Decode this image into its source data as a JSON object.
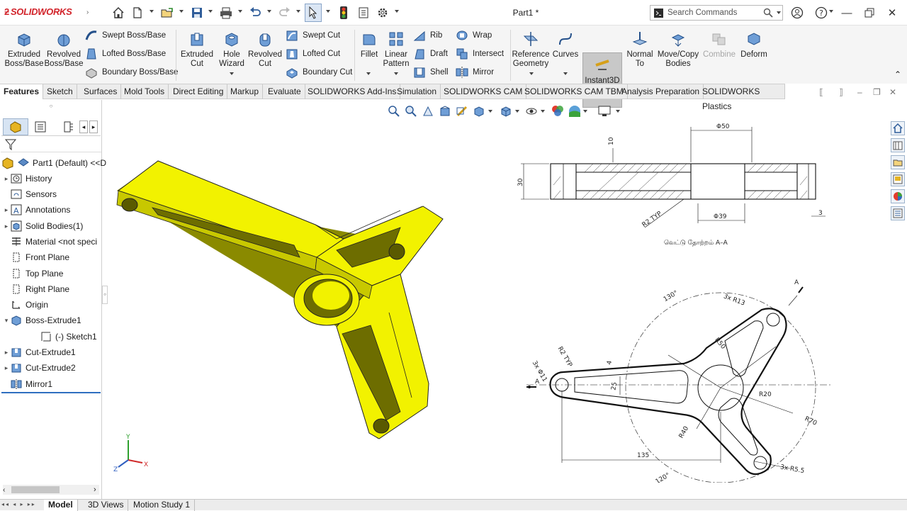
{
  "app": {
    "brand": "SOLIDWORKS",
    "doc_title": "Part1 *",
    "search_placeholder": "Search Commands"
  },
  "ribbon": {
    "extruded_boss": "Extruded Boss/Base",
    "extruded_boss_l1": "Extruded",
    "extruded_boss_l2": "Boss/Base",
    "revolved_boss_l1": "Revolved",
    "revolved_boss_l2": "Boss/Base",
    "swept_boss": "Swept Boss/Base",
    "lofted_boss": "Lofted Boss/Base",
    "boundary_boss": "Boundary Boss/Base",
    "extruded_cut_l1": "Extruded",
    "extruded_cut_l2": "Cut",
    "hole_wizard_l1": "Hole",
    "hole_wizard_l2": "Wizard",
    "revolved_cut_l1": "Revolved",
    "revolved_cut_l2": "Cut",
    "swept_cut": "Swept Cut",
    "lofted_cut": "Lofted Cut",
    "boundary_cut": "Boundary Cut",
    "fillet": "Fillet",
    "linear_pattern_l1": "Linear",
    "linear_pattern_l2": "Pattern",
    "rib": "Rib",
    "draft": "Draft",
    "shell": "Shell",
    "wrap": "Wrap",
    "intersect": "Intersect",
    "mirror": "Mirror",
    "ref_geom_l1": "Reference",
    "ref_geom_l2": "Geometry",
    "curves": "Curves",
    "instant3d": "Instant3D",
    "normal_to_l1": "Normal",
    "normal_to_l2": "To",
    "move_copy_l1": "Move/Copy",
    "move_copy_l2": "Bodies",
    "combine": "Combine",
    "deform": "Deform"
  },
  "tabs": [
    "Features",
    "Sketch",
    "Surfaces",
    "Mold Tools",
    "Direct Editing",
    "Markup",
    "Evaluate",
    "SOLIDWORKS Add-Ins",
    "Simulation",
    "SOLIDWORKS CAM",
    "SOLIDWORKS CAM TBM",
    "Analysis Preparation",
    "SOLIDWORKS Plastics"
  ],
  "tree": {
    "root": "Part1 (Default) <<D",
    "items": [
      "History",
      "Sensors",
      "Annotations",
      "Solid Bodies(1)",
      "Material <not speci",
      "Front Plane",
      "Top Plane",
      "Right Plane",
      "Origin",
      "Boss-Extrude1",
      "(-) Sketch1",
      "Cut-Extrude1",
      "Cut-Extrude2",
      "Mirror1"
    ]
  },
  "bottom_tabs": [
    "Model",
    "3D Views",
    "Motion Study 1"
  ],
  "drawing": {
    "section_label": "வெட்டு தோற்றம் A–A",
    "dims_section": [
      "Φ50",
      "10",
      "30",
      "R2 TYP",
      "Φ39",
      "3"
    ],
    "dims_plan": [
      "A",
      "130°",
      "3x R13",
      "R50",
      "3x Φ11",
      "R2 TYP",
      "4",
      "25",
      "R20",
      "R70",
      "R40",
      "135",
      "120°",
      "3x R5.5",
      "A"
    ]
  },
  "triad": {
    "x": "X",
    "y": "Y",
    "z": "Z"
  },
  "colors": {
    "part": "#f2f200",
    "part_shade": "#8a8a00",
    "accent": "#1e5aa8",
    "brand": "#d2232a"
  }
}
